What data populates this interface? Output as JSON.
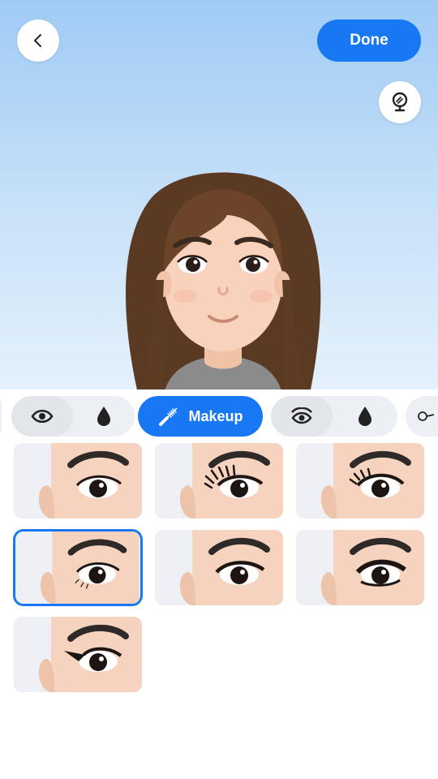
{
  "header": {
    "back_icon": "chevron-left-icon",
    "done_label": "Done",
    "mirror_icon": "mirror-icon"
  },
  "colors": {
    "accent": "#1877f2",
    "background_top": "#9fcbf5",
    "background_bottom": "#e4f1fc",
    "selected_border": "#1877f2"
  },
  "tabs": [
    {
      "icon": "eye-icon"
    },
    {
      "icon": "drop-icon"
    },
    {
      "icon": "mascara-icon",
      "label": "Makeup",
      "active": true
    },
    {
      "icon": "eye-open-icon"
    },
    {
      "icon": "drop-icon"
    },
    {
      "icon": "glasses-icon"
    }
  ],
  "options": [
    {
      "style": "natural",
      "selected": false
    },
    {
      "style": "long-lashes",
      "selected": false
    },
    {
      "style": "volume-lashes",
      "selected": false
    },
    {
      "style": "subtle-lower-lashes",
      "selected": true
    },
    {
      "style": "thin-liner",
      "selected": false
    },
    {
      "style": "bold-liner",
      "selected": false
    },
    {
      "style": "winged-liner",
      "selected": false
    }
  ]
}
